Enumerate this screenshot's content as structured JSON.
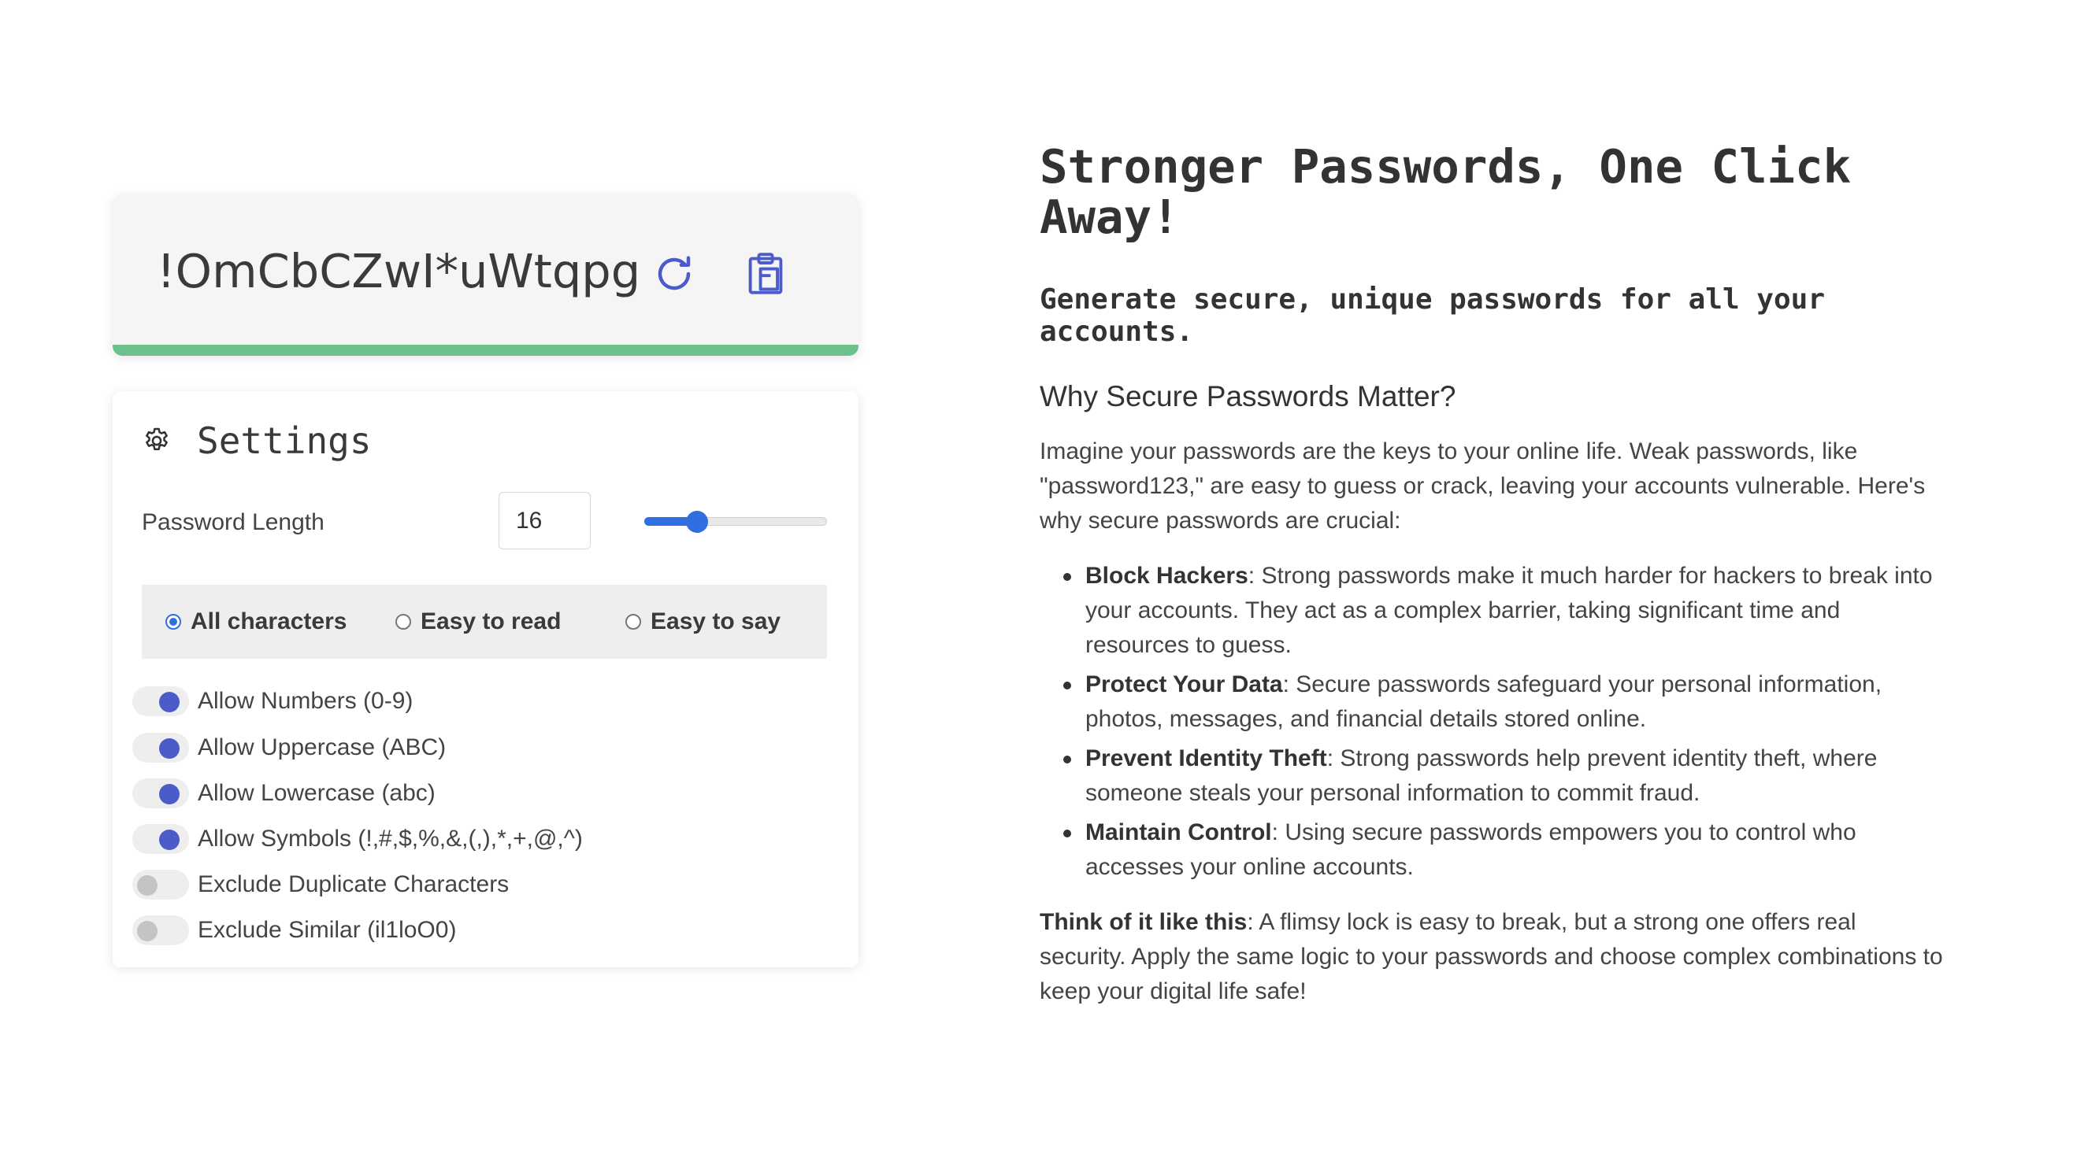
{
  "password": {
    "value": "!OmCbCZwI*uWtqpg",
    "strength_color": "#6cc08b",
    "refresh_icon": "refresh-icon",
    "copy_icon": "clipboard-icon"
  },
  "settings": {
    "title": "Settings",
    "gear_icon": "gear-icon",
    "length_label": "Password Length",
    "length_value": "16",
    "length_slider_fraction": 0.26,
    "modes": [
      {
        "label": "All characters",
        "selected": true
      },
      {
        "label": "Easy to read",
        "selected": false
      },
      {
        "label": "Easy to say",
        "selected": false
      }
    ],
    "toggles": [
      {
        "label": "Allow Numbers (0-9)",
        "on": true
      },
      {
        "label": "Allow Uppercase (ABC)",
        "on": true
      },
      {
        "label": "Allow Lowercase (abc)",
        "on": true
      },
      {
        "label": "Allow Symbols (!,#,$,%,&,(,),*,+,@,^)",
        "on": true
      },
      {
        "label": "Exclude Duplicate Characters",
        "on": false
      },
      {
        "label": "Exclude Similar (il1loO0)",
        "on": false
      }
    ],
    "accent": "#2f6fe0",
    "toggle_on_color": "#4b5bc8"
  },
  "info": {
    "headline": "Stronger Passwords, One Click Away!",
    "subheadline": "Generate secure, unique passwords for all your accounts.",
    "why_title": "Why Secure Passwords Matter?",
    "intro": "Imagine your passwords are the keys to your online life. Weak passwords, like \"password123,\" are easy to guess or crack, leaving your accounts vulnerable. Here's why secure passwords are crucial:",
    "reasons": [
      {
        "title": "Block Hackers",
        "text": ": Strong passwords make it much harder for hackers to break into your accounts. They act as a complex barrier, taking significant time and resources to guess."
      },
      {
        "title": "Protect Your Data",
        "text": ": Secure passwords safeguard your personal information, photos, messages, and financial details stored online."
      },
      {
        "title": "Prevent Identity Theft",
        "text": ": Strong passwords help prevent identity theft, where someone steals your personal information to commit fraud."
      },
      {
        "title": "Maintain Control",
        "text": ": Using secure passwords empowers you to control who accesses your online accounts."
      }
    ],
    "think_title": "Think of it like this",
    "think_text": ": A flimsy lock is easy to break, but a strong one offers real security. Apply the same logic to your passwords and choose complex combinations to keep your digital life safe!"
  }
}
